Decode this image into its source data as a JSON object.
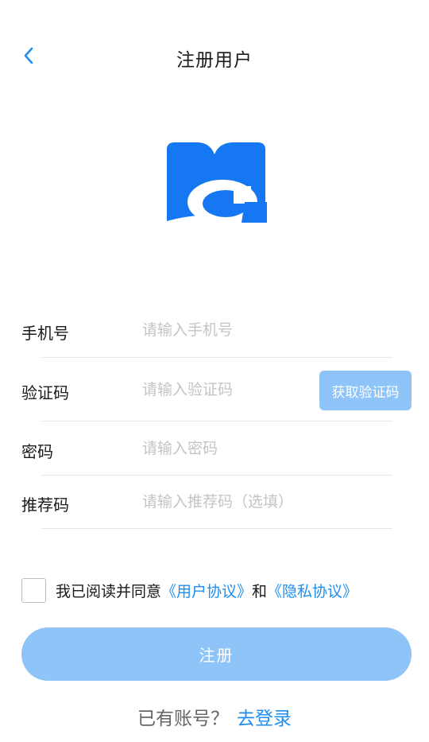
{
  "header": {
    "title": "注册用户"
  },
  "form": {
    "phone": {
      "label": "手机号",
      "placeholder": "请输入手机号"
    },
    "code": {
      "label": "验证码",
      "placeholder": "请输入验证码",
      "button": "获取验证码"
    },
    "password": {
      "label": "密码",
      "placeholder": "请输入密码"
    },
    "referral": {
      "label": "推荐码",
      "placeholder": "请输入推荐码（选填）"
    }
  },
  "agreement": {
    "prefix": "我已阅读并同意",
    "user_agreement": "《用户协议》",
    "joiner": "和",
    "privacy_agreement": "《隐私协议》",
    "checked": false
  },
  "register_button": "注册",
  "login_prompt": {
    "text": "已有账号？",
    "link": "去登录"
  },
  "colors": {
    "accent": "#1e8ef0",
    "logo": "#1677f2",
    "button_disabled": "#8ec4f8"
  }
}
